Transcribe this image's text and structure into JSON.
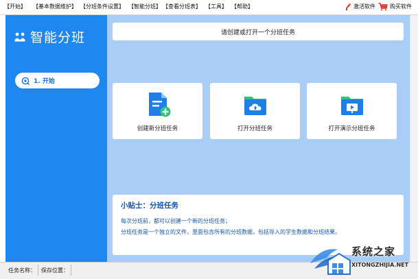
{
  "menu": {
    "items": [
      "【开始】",
      "【基本数据维护】",
      "【分班条件设置】",
      "【智能分班】",
      "【查看分班表】",
      "【工具】",
      "【帮助】"
    ],
    "activate": "激活软件",
    "buy": "购买软件"
  },
  "sidebar": {
    "brand": "智能分班",
    "nav": [
      {
        "label": "1. 开始"
      }
    ]
  },
  "main": {
    "hint": "请创建或打开一个分班任务",
    "cards": [
      {
        "label": "创建新分班任务",
        "icon": "new-file-icon"
      },
      {
        "label": "打开分班任务",
        "icon": "cloud-folder-icon"
      },
      {
        "label": "打开演示分班任务",
        "icon": "demo-folder-icon"
      }
    ],
    "tips": {
      "title": "小贴士：分班任务",
      "lines": [
        "每次分班前，都可以创建一个新的分班任务；",
        "分班任务是一个独立的文件，里面包含所有的分班数据，包括导入的学生数据和分班结果。"
      ]
    }
  },
  "status": {
    "task_name_label": "任务名称：",
    "save_location_label": "保存位置："
  },
  "watermark": {
    "title": "系统之家",
    "url": "XITONGZHIJIA.NET"
  },
  "colors": {
    "sidebar": "#1e88f0",
    "main_bg": "#a9cdf6",
    "accent_text": "#1553a8"
  }
}
